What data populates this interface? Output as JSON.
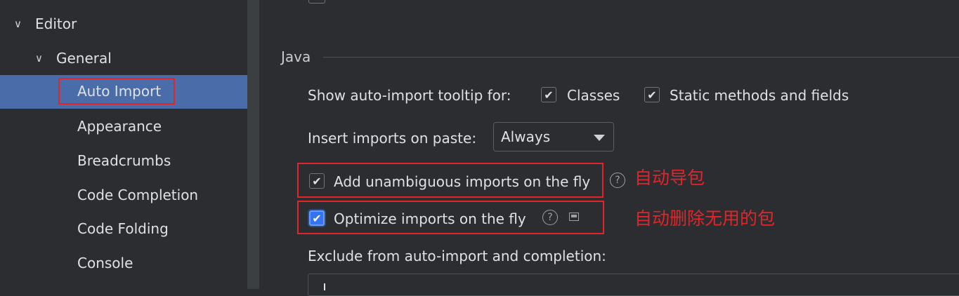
{
  "sidebar": {
    "items": [
      {
        "label": "Editor"
      },
      {
        "label": "General"
      },
      {
        "label": "Auto Import"
      },
      {
        "label": "Appearance"
      },
      {
        "label": "Breadcrumbs"
      },
      {
        "label": "Code Completion"
      },
      {
        "label": "Code Folding"
      },
      {
        "label": "Console"
      }
    ]
  },
  "main": {
    "section_title": "Java",
    "tooltip_label": "Show auto-import tooltip for:",
    "classes_label": "Classes",
    "static_label": "Static methods and fields",
    "paste_label": "Insert imports on paste:",
    "paste_value": "Always",
    "add_unambiguous_label": "Add unambiguous imports on the fly",
    "optimize_label": "Optimize imports on the fly",
    "exclude_label": "Exclude from auto-import and completion:"
  },
  "annotations": {
    "auto_import": "自动导包",
    "auto_remove": "自动删除无用的包"
  },
  "colors": {
    "background": "#2b2d30",
    "selection": "#4a6ca8",
    "annotation": "#e0262b",
    "checkbox_focus": "#3574f0"
  }
}
